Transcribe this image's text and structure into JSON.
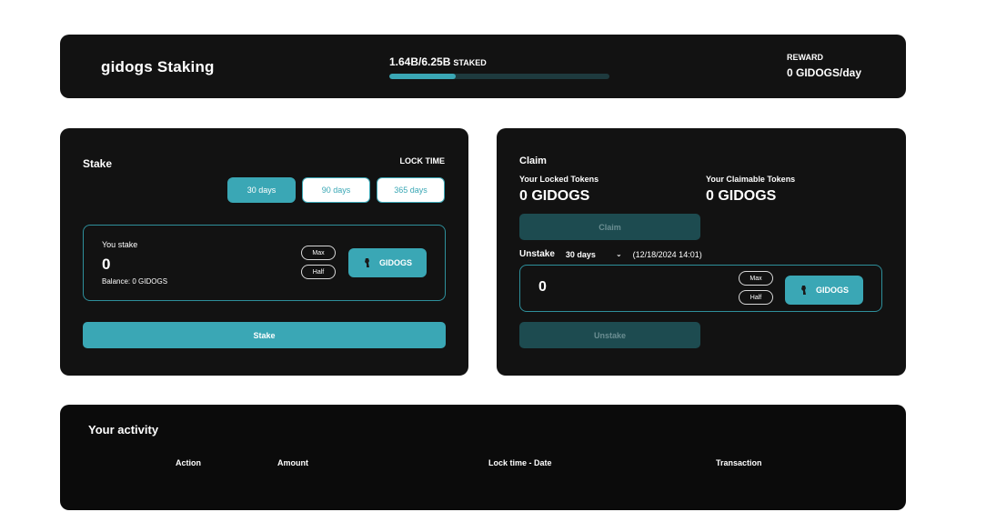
{
  "header": {
    "title": "gidogs Staking",
    "staked_amount": "1.64B/6.25B",
    "staked_suffix": "STAKED",
    "staked_progress": 0.3,
    "reward_label": "REWARD",
    "reward_value": "0 GIDOGS/day"
  },
  "stake": {
    "title": "Stake",
    "lock_time_label": "LOCK TIME",
    "lock_options": [
      "30 days",
      "90 days",
      "365 days"
    ],
    "selected_lock": "30 days",
    "input_label": "You stake",
    "input_value": "0",
    "balance": "Balance: 0 GIDOGS",
    "max_label": "Max",
    "half_label": "Half",
    "token_label": "GIDOGS",
    "token_icon": "gidogs-token-icon",
    "submit_label": "Stake"
  },
  "claim": {
    "title": "Claim",
    "locked_label": "Your Locked Tokens",
    "locked_value": "0 GIDOGS",
    "claimable_label": "Your Claimable Tokens",
    "claimable_value": "0 GIDOGS",
    "claim_button": "Claim",
    "unstake_label": "Unstake",
    "unstake_period": "30 days",
    "unstake_date": "(12/18/2024 14:01)",
    "input_value": "0",
    "max_label": "Max",
    "half_label": "Half",
    "token_label": "GIDOGS",
    "unstake_button": "Unstake"
  },
  "activity": {
    "title": "Your activity",
    "columns": [
      "Action",
      "Amount",
      "Lock time - Date",
      "Transaction"
    ]
  },
  "colors": {
    "accent": "#3aa7b5",
    "panel": "#121212",
    "disabled": "#1d4b50"
  }
}
